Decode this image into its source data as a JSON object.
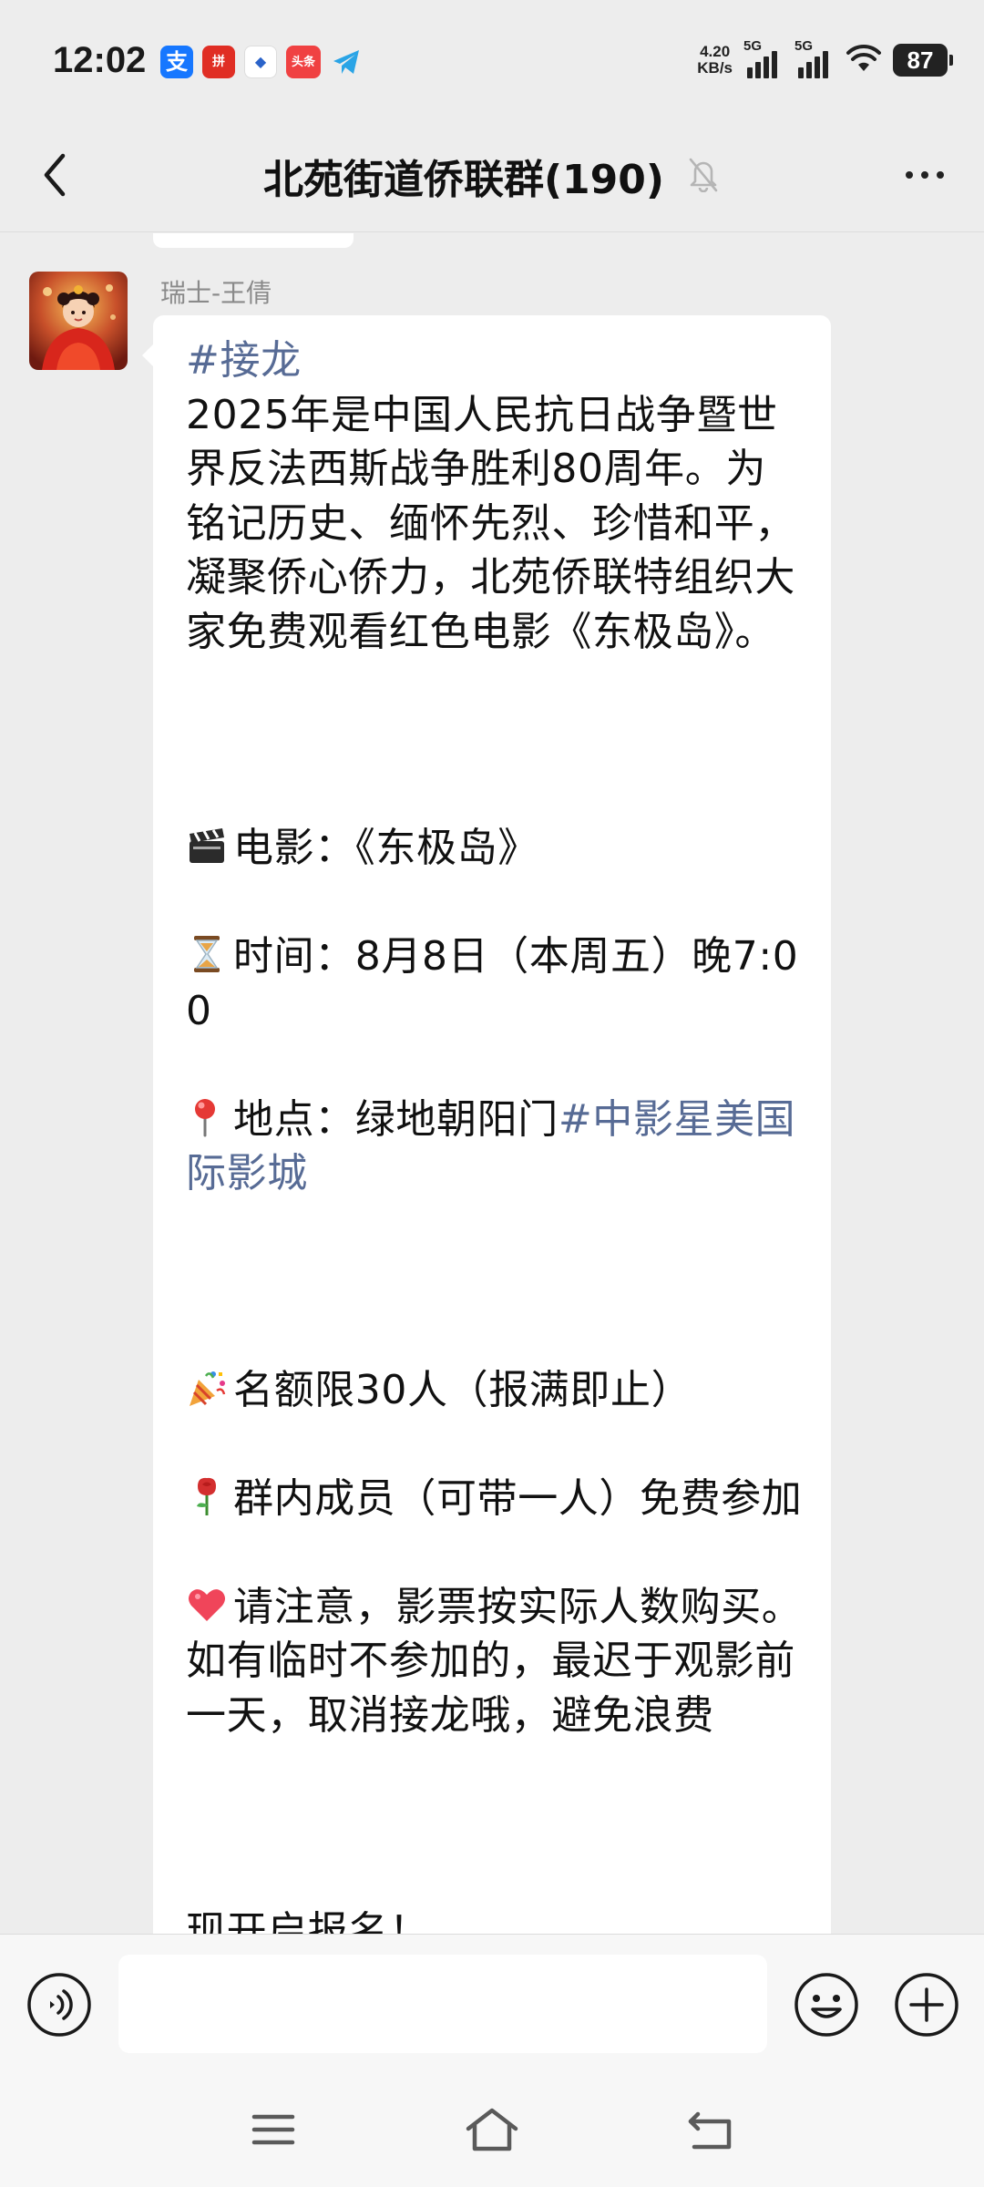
{
  "status_bar": {
    "time": "12:02",
    "notification_icons": [
      {
        "name": "alipay-icon",
        "glyph": "支"
      },
      {
        "name": "pinduoduo-icon",
        "glyph": "拼"
      },
      {
        "name": "map-icon",
        "glyph": "◆"
      },
      {
        "name": "toutiao-icon",
        "glyph": "头条"
      },
      {
        "name": "telegram-icon",
        "glyph": ""
      }
    ],
    "net_speed_value": "4.20",
    "net_speed_unit": "KB/s",
    "signal_1_label": "5G",
    "signal_2_label": "5G",
    "battery": "87"
  },
  "nav": {
    "title": "北苑街道侨联群(190)"
  },
  "message": {
    "sender": "瑞士-王倩",
    "hashtag": "#接龙",
    "intro": "2025年是中国人民抗日战争暨世界反法西斯战争胜利80周年。为铭记历史、缅怀先烈、珍惜和平，凝聚侨心侨力，北苑侨联特组织大家免费观看红色电影《东极岛》。",
    "movie_line": "电影：《东极岛》",
    "time_line": "时间：8月8日（本周五）晚7:00",
    "location_prefix": "地点：绿地朝阳门",
    "location_link": "#中影星美国际影城",
    "quota_line": "名额限30人（报满即止）",
    "members_line": "群内成员（可带一人）免费参加",
    "notice_line": "请注意，影票按实际人数购买。如有临时不参加的，最迟于观影前一天，取消接龙哦，避免浪费",
    "signup_line": "现开启报名！"
  },
  "input_bar": {
    "placeholder": ""
  },
  "colors": {
    "background": "#EDEDED",
    "bubble": "#FFFFFF",
    "link": "#576B95",
    "sender_name": "#8A8A8A"
  }
}
